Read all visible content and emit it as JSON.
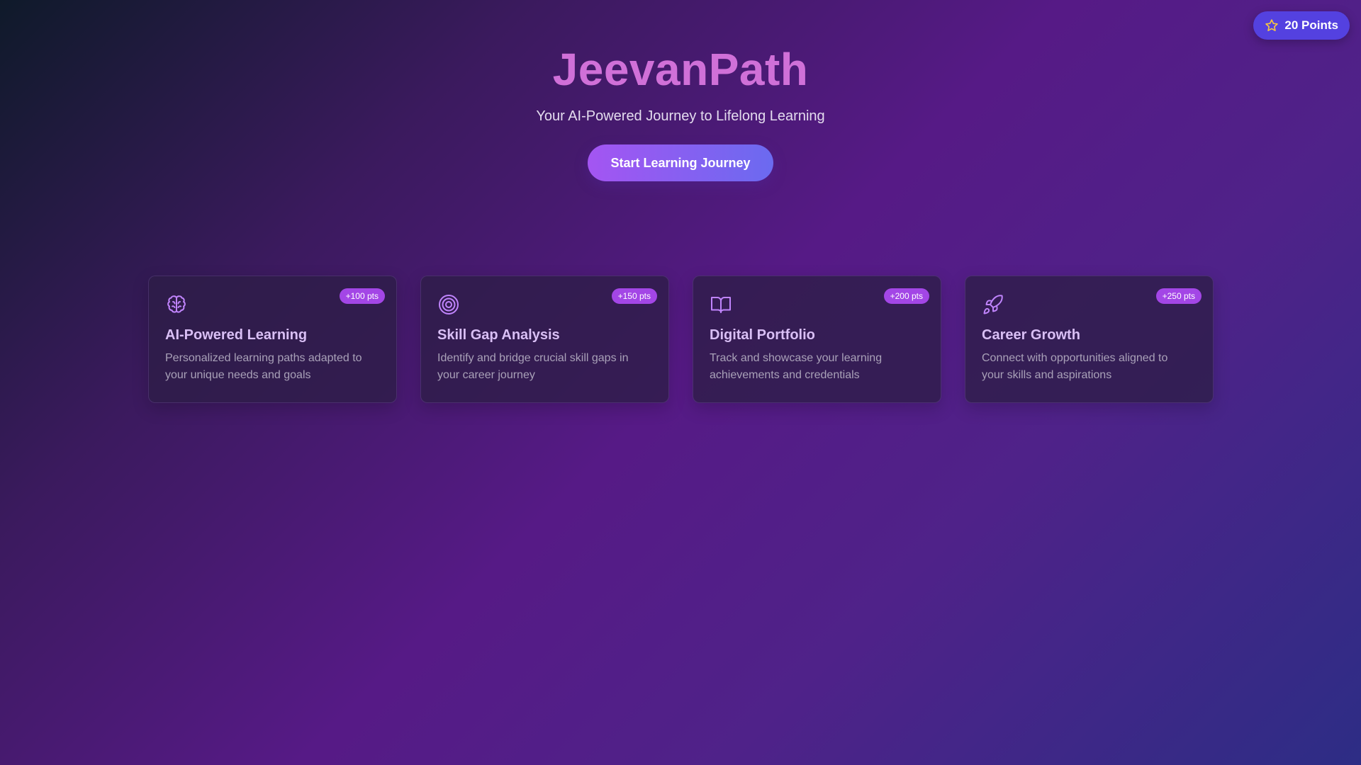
{
  "points": {
    "label": "20 Points",
    "icon": "star-icon"
  },
  "hero": {
    "title": "JeevanPath",
    "subtitle": "Your AI-Powered Journey to Lifelong Learning",
    "cta_label": "Start Learning Journey"
  },
  "cards": [
    {
      "icon": "brain-icon",
      "pts": "+100 pts",
      "title": "AI-Powered Learning",
      "desc": "Personalized learning paths adapted to your unique needs and goals"
    },
    {
      "icon": "target-icon",
      "pts": "+150 pts",
      "title": "Skill Gap Analysis",
      "desc": "Identify and bridge crucial skill gaps in your career journey"
    },
    {
      "icon": "book-open-icon",
      "pts": "+200 pts",
      "title": "Digital Portfolio",
      "desc": "Track and showcase your learning achievements and credentials"
    },
    {
      "icon": "rocket-icon",
      "pts": "+250 pts",
      "title": "Career Growth",
      "desc": "Connect with opportunities aligned to your skills and aspirations"
    }
  ],
  "colors": {
    "accent": "#c084fc",
    "title": "#d070d8",
    "badge": "#5441e0",
    "pts_badge": "#a346e6",
    "star": "#f5c542"
  }
}
